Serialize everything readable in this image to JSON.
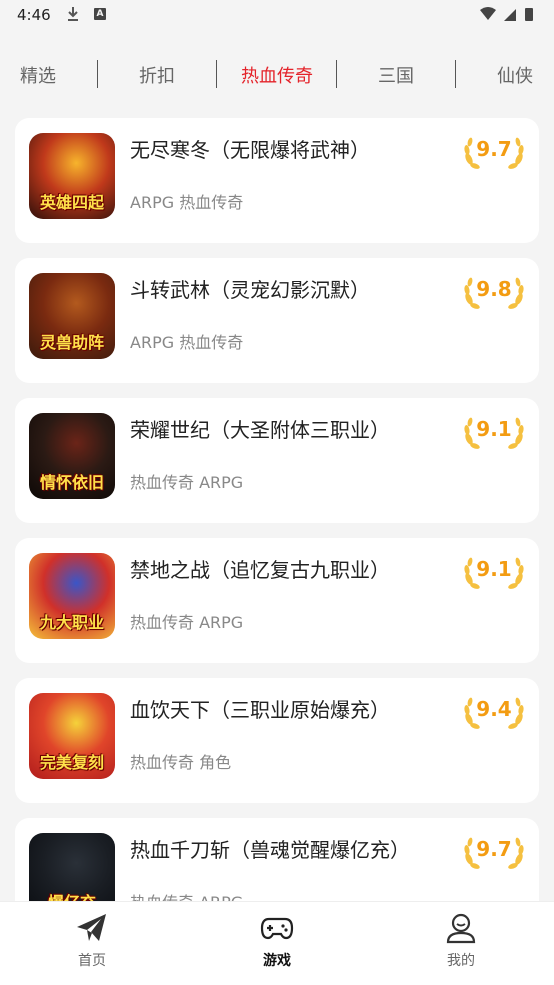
{
  "status_bar": {
    "time": "4:46"
  },
  "tabs": [
    {
      "label": "精选"
    },
    {
      "label": "折扣"
    },
    {
      "label": "热血传奇"
    },
    {
      "label": "三国"
    },
    {
      "label": "仙侠"
    }
  ],
  "active_tab": "热血传奇",
  "games": [
    {
      "title": "无尽寒冬（无限爆将武神）",
      "tags": "ARPG 热血传奇",
      "score": "9.7",
      "icon_caption": "英雄四起",
      "icon_colors": [
        "#f7b42c",
        "#c0391b",
        "#2d0f0a"
      ]
    },
    {
      "title": "斗转武林（灵宠幻影沉默）",
      "tags": "ARPG 热血传奇",
      "score": "9.8",
      "icon_caption": "灵兽助阵",
      "icon_colors": [
        "#b35a1e",
        "#7a2a10",
        "#3a1a0c"
      ]
    },
    {
      "title": "荣耀世纪（大圣附体三职业）",
      "tags": "热血传奇 ARPG",
      "score": "9.1",
      "icon_caption": "情怀依旧",
      "icon_colors": [
        "#6b2418",
        "#2b1a14",
        "#0c0806"
      ]
    },
    {
      "title": "禁地之战（追忆复古九职业）",
      "tags": "热血传奇 ARPG",
      "score": "9.1",
      "icon_caption": "九大职业",
      "icon_colors": [
        "#3a56c8",
        "#d0302a",
        "#f5c23a"
      ]
    },
    {
      "title": "血饮天下（三职业原始爆充）",
      "tags": "热血传奇 角色",
      "score": "9.4",
      "icon_caption": "完美复刻",
      "icon_colors": [
        "#f5d23a",
        "#e0452a",
        "#b01c1c"
      ]
    },
    {
      "title": "热血千刀斩（兽魂觉醒爆亿充）",
      "tags": "热血传奇 ARPG",
      "score": "9.7",
      "icon_caption": "爆亿充",
      "icon_colors": [
        "#2a3038",
        "#1a1e24",
        "#0a0c10"
      ]
    }
  ],
  "bottom_nav": [
    {
      "label": "首页",
      "icon": "paper-plane-icon"
    },
    {
      "label": "游戏",
      "icon": "gamepad-icon"
    },
    {
      "label": "我的",
      "icon": "user-icon"
    }
  ],
  "active_nav": "游戏",
  "colors": {
    "accent": "#e4232a",
    "score": "#f39c12",
    "background": "#f4f4f4"
  }
}
